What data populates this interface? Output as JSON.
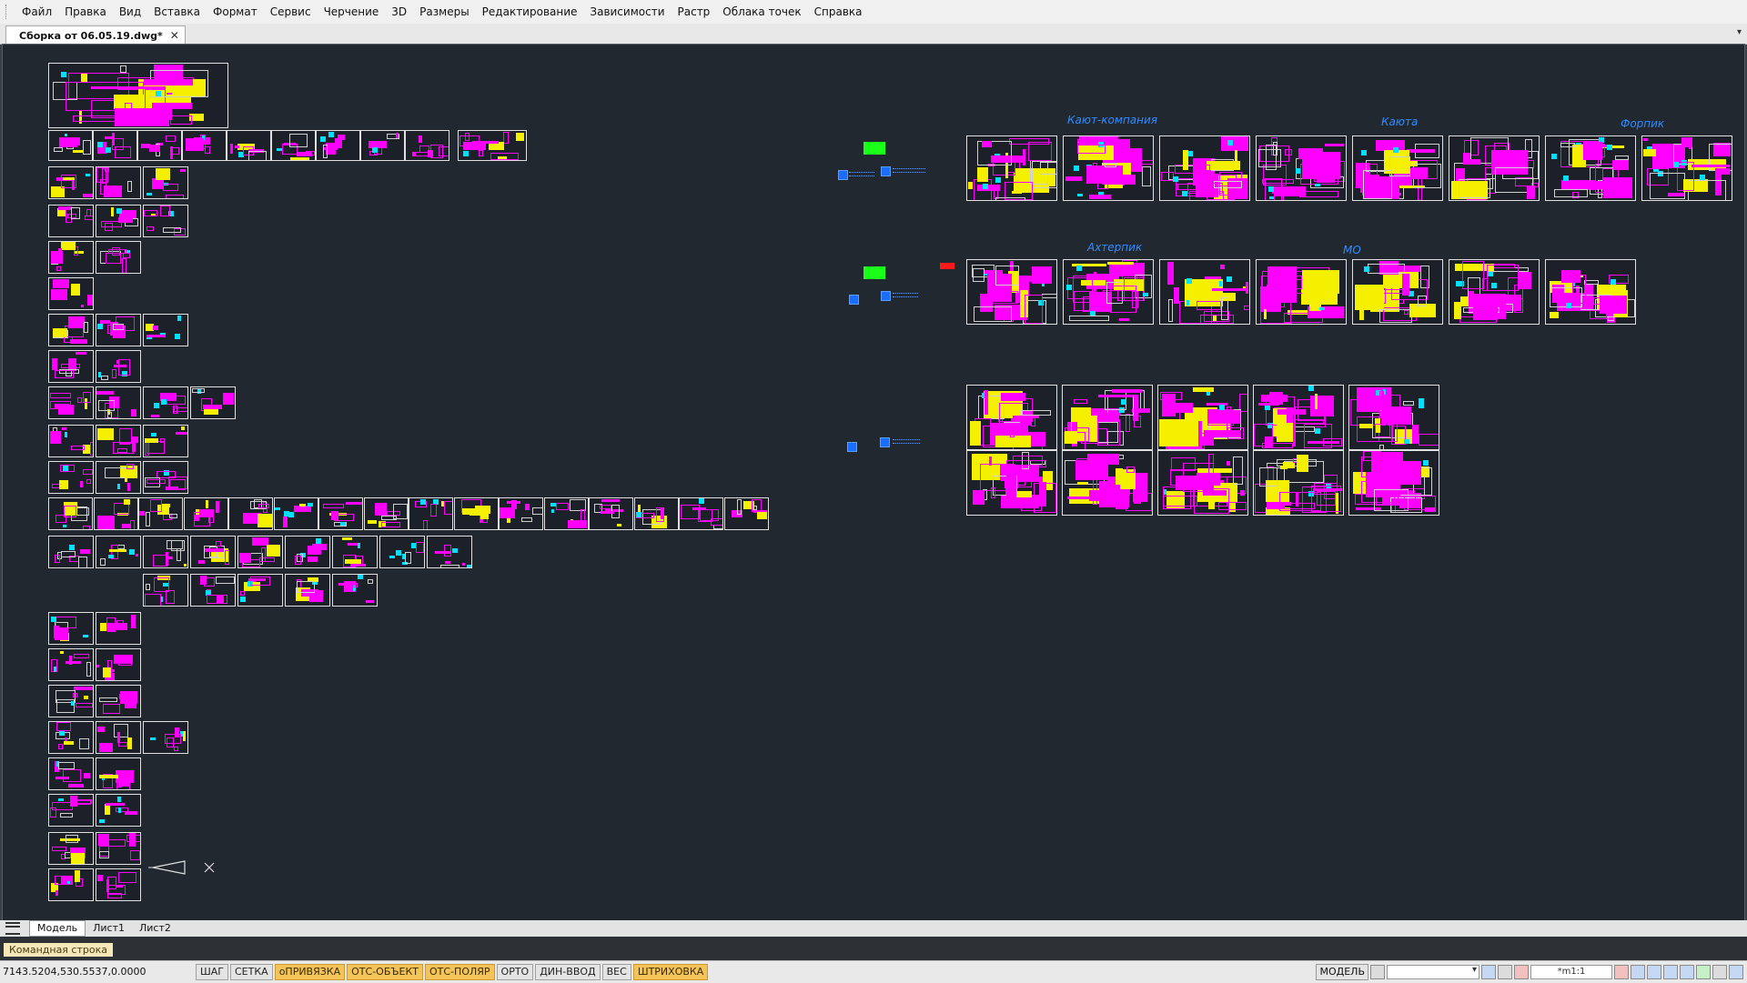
{
  "menu": [
    "Файл",
    "Правка",
    "Вид",
    "Вставка",
    "Формат",
    "Сервис",
    "Черчение",
    "3D",
    "Размеры",
    "Редактирование",
    "Зависимости",
    "Растр",
    "Облака точек",
    "Справка"
  ],
  "document_tab": {
    "title": "Сборка от 06.05.19.dwg*",
    "close": "✕"
  },
  "canvas": {
    "group_labels": [
      "Кают-компания",
      "Каюта",
      "Форпик",
      "Ахтерпик",
      "МО"
    ]
  },
  "layout_tabs": [
    "Модель",
    "Лист1",
    "Лист2"
  ],
  "command_line": {
    "label": "Командная строка"
  },
  "status": {
    "coordinates": "7143.5204,530.5537,0.0000",
    "toggles": [
      {
        "label": "ШАГ",
        "on": false
      },
      {
        "label": "СЕТКА",
        "on": false
      },
      {
        "label": "оПРИВЯЗКА",
        "on": true
      },
      {
        "label": "ОТС-ОБЪЕКТ",
        "on": true
      },
      {
        "label": "ОТС-ПОЛЯР",
        "on": true
      },
      {
        "label": "ОРТО",
        "on": false
      },
      {
        "label": "ДИН-ВВОД",
        "on": false
      },
      {
        "label": "ВЕС",
        "on": false
      },
      {
        "label": "ШТРИХОВКА",
        "on": true
      }
    ],
    "model_label": "МОДЕЛЬ",
    "scale": "*m1:1"
  }
}
